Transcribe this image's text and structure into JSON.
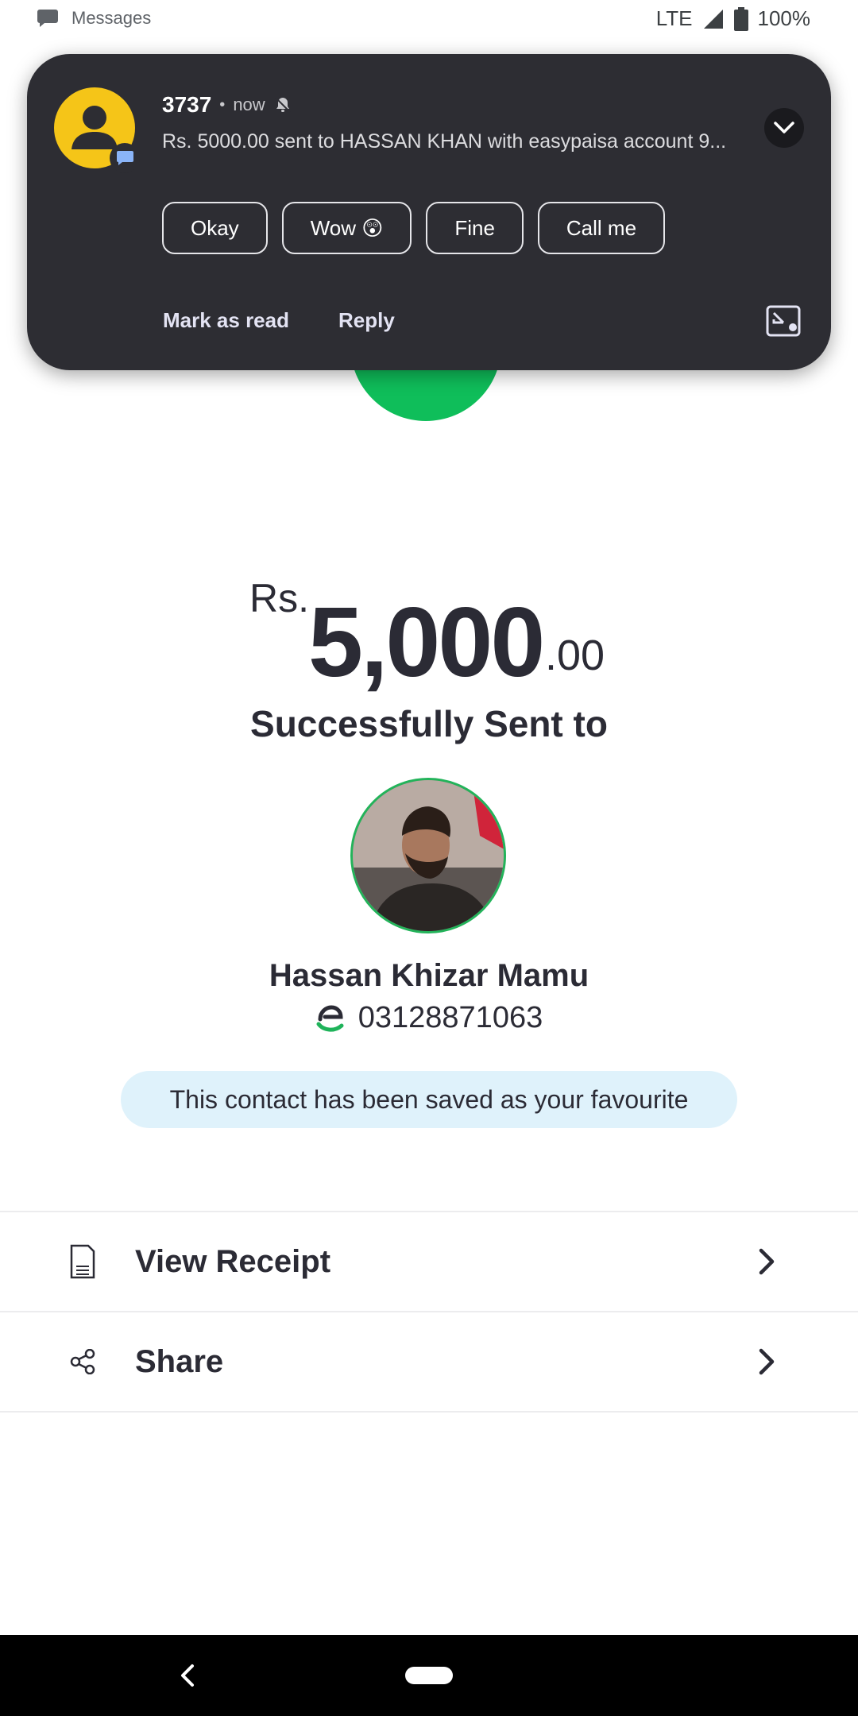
{
  "status_bar": {
    "app_label": "Messages",
    "network": "LTE",
    "battery": "100%"
  },
  "notification": {
    "sender": "3737",
    "separator": "•",
    "time": "now",
    "body": "Rs. 5000.00 sent to HASSAN KHAN with easypaisa account 9...",
    "quick_replies": [
      "Okay",
      "Wow 😲",
      "Fine",
      "Call me"
    ],
    "actions": {
      "mark_read": "Mark as read",
      "reply": "Reply"
    }
  },
  "transaction": {
    "currency": "Rs.",
    "amount_integer": "5,000",
    "amount_decimal": ".00",
    "status_text": "Successfully Sent to"
  },
  "recipient": {
    "name": "Hassan Khizar Mamu",
    "number": "03128871063",
    "favourite_message": "This contact has been saved as your favourite"
  },
  "options": {
    "view_receipt": "View Receipt",
    "share": "Share"
  },
  "colors": {
    "success_green": "#0fbe5a",
    "notification_bg": "#2d2d33",
    "avatar_yellow": "#f5c518",
    "favourite_bg": "#dff2fb",
    "text_dark": "#2b2b35"
  },
  "icons": {
    "status_app": "chat-bubble-icon",
    "signal": "signal-icon",
    "battery": "battery-icon",
    "silent": "bell-off-icon",
    "expand": "chevron-down-icon",
    "bubble": "open-in-bubble-icon",
    "receipt": "receipt-icon",
    "share": "share-icon",
    "chevron": "chevron-right-icon",
    "wallet": "easypaisa-logo-icon"
  }
}
